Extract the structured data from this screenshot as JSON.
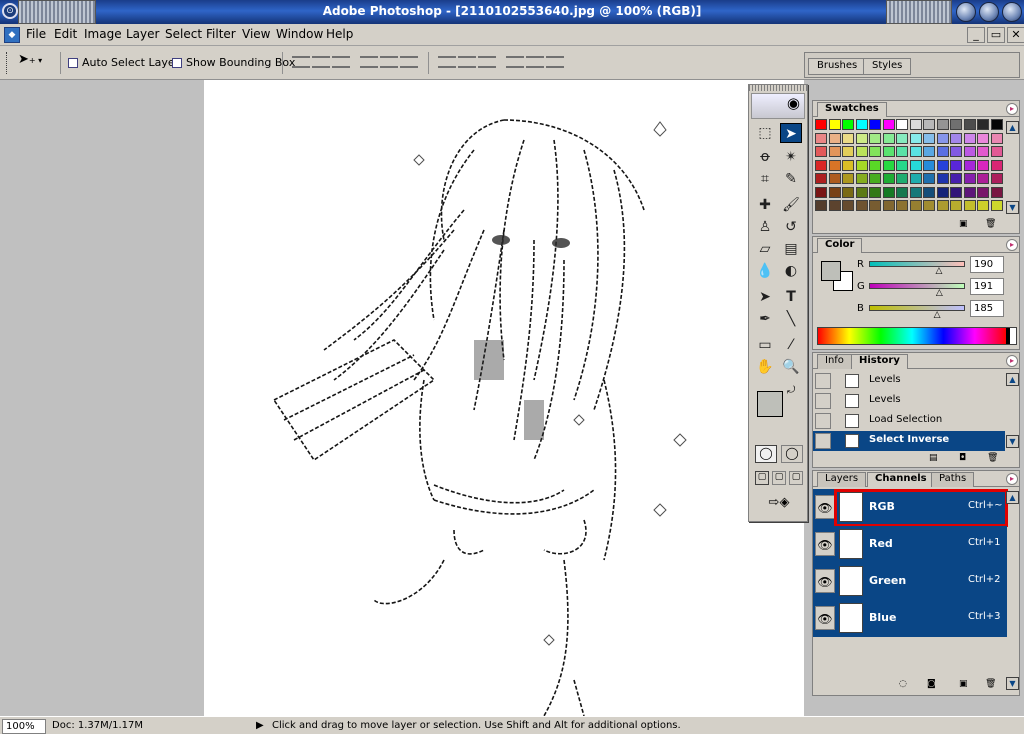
{
  "window": {
    "title": "Adobe Photoshop - [2110102553640.jpg @ 100% (RGB)]"
  },
  "menu": [
    "File",
    "Edit",
    "Image",
    "Layer",
    "Select",
    "Filter",
    "View",
    "Window",
    "Help"
  ],
  "mdi_buttons": [
    "_",
    "▭",
    "✕"
  ],
  "options": {
    "auto_select": "Auto Select Layer",
    "bounding_box": "Show Bounding Box"
  },
  "well": {
    "brushes": "Brushes",
    "styles": "Styles"
  },
  "swatches": {
    "tab": "Swatches"
  },
  "color": {
    "tab": "Color",
    "r_label": "R",
    "g_label": "G",
    "b_label": "B",
    "r": "190",
    "g": "191",
    "b": "185",
    "foreground": "#bebfb9"
  },
  "history": {
    "tabs": [
      "Info",
      "History"
    ],
    "items": [
      "Levels",
      "Levels",
      "Load Selection",
      "Select Inverse"
    ]
  },
  "channels": {
    "tabs": [
      "Layers",
      "Channels",
      "Paths"
    ],
    "items": [
      {
        "name": "RGB",
        "shortcut": "Ctrl+~"
      },
      {
        "name": "Red",
        "shortcut": "Ctrl+1"
      },
      {
        "name": "Green",
        "shortcut": "Ctrl+2"
      },
      {
        "name": "Blue",
        "shortcut": "Ctrl+3"
      }
    ]
  },
  "status": {
    "zoom": "100%",
    "doc": "Doc: 1.37M/1.17M",
    "hint": "Click and drag to move layer or selection.  Use Shift and Alt for additional options."
  },
  "colors": {
    "selection": "#0a4686",
    "highlight_border": "#e00000",
    "titlebar": "#2f65c8"
  }
}
